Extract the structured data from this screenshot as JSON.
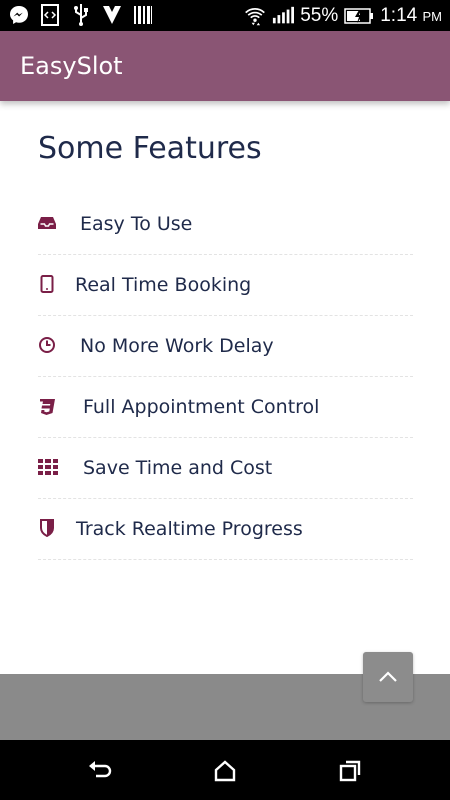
{
  "status_bar": {
    "battery_percent": "55%",
    "time": "1:14",
    "time_suffix": "PM",
    "left_icons": [
      "messenger-icon",
      "code-icon",
      "usb-icon",
      "check-app-icon",
      "barcode-icon"
    ],
    "right_icons": [
      "wifi-icon",
      "signal-icon",
      "battery-charging-icon"
    ]
  },
  "app_bar": {
    "title": "EasySlot",
    "color": "#8a5574"
  },
  "main": {
    "section_title": "Some Features",
    "features": [
      {
        "label": "Easy To Use",
        "icon": "inbox-icon"
      },
      {
        "label": "Real Time Booking",
        "icon": "tablet-icon"
      },
      {
        "label": "No More Work Delay",
        "icon": "clock-icon"
      },
      {
        "label": "Full Appointment Control",
        "icon": "css3-icon"
      },
      {
        "label": "Save Time and Cost",
        "icon": "grid-icon"
      },
      {
        "label": "Track Realtime Progress",
        "icon": "shield-icon"
      }
    ],
    "accent_color": "#7a1f47",
    "text_color": "#1f2a4a"
  },
  "nav_bar": {
    "buttons": [
      "back-icon",
      "home-icon",
      "recents-icon"
    ]
  }
}
